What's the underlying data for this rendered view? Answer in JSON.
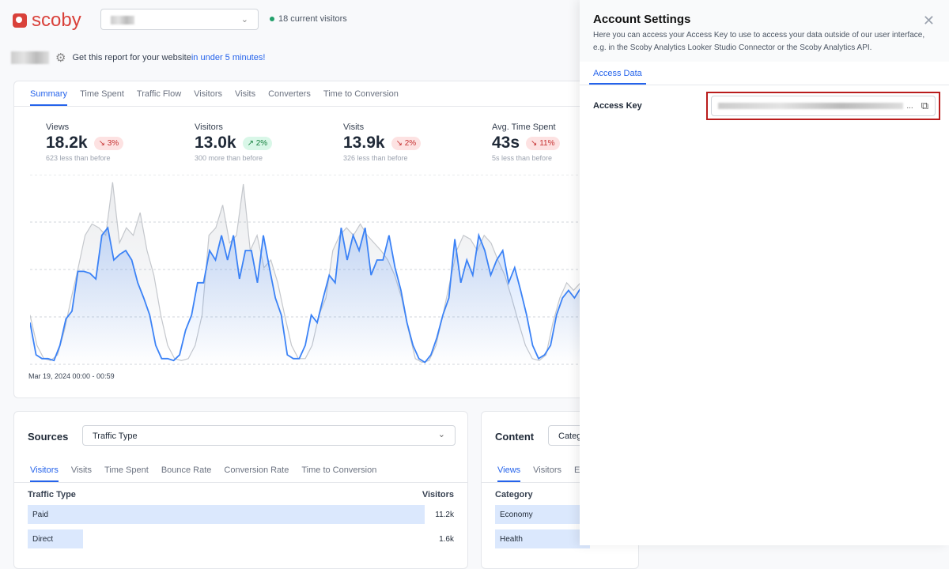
{
  "header": {
    "logo": "scoby",
    "site_select_icon": "chevron-down-icon",
    "current_visitors": "18 current visitors",
    "status_color": "#22a06b"
  },
  "promo": {
    "text": "Get this report for your website ",
    "link": "in under 5 minutes!"
  },
  "summary": {
    "tabs": [
      "Summary",
      "Time Spent",
      "Traffic Flow",
      "Visitors",
      "Visits",
      "Converters",
      "Time to Conversion"
    ],
    "kpis": [
      {
        "label": "Views",
        "value": "18.2k",
        "change": "3%",
        "direction": "down",
        "sub": "623 less than before"
      },
      {
        "label": "Visitors",
        "value": "13.0k",
        "change": "2%",
        "direction": "up",
        "sub": "300 more than before"
      },
      {
        "label": "Visits",
        "value": "13.9k",
        "change": "2%",
        "direction": "down",
        "sub": "326 less than before"
      },
      {
        "label": "Avg. Time Spent",
        "value": "43s",
        "change": "11%",
        "direction": "down",
        "sub": "5s less than before"
      }
    ],
    "date_label": "Mar 19, 2024 00:00 - 00:59"
  },
  "chart_data": {
    "type": "area",
    "grid": true,
    "series": [
      {
        "color": "#3b82f6",
        "values": [
          22,
          5,
          3,
          3,
          2,
          10,
          24,
          28,
          49,
          49,
          48,
          45,
          68,
          72,
          55,
          58,
          60,
          55,
          43,
          35,
          26,
          10,
          3,
          3,
          2,
          5,
          18,
          26,
          43,
          43,
          60,
          55,
          68,
          55,
          68,
          45,
          60,
          60,
          43,
          68,
          51,
          35,
          26,
          5,
          3,
          3,
          10,
          26,
          22,
          35,
          47,
          43,
          72,
          55,
          68,
          60,
          72,
          47,
          55,
          55,
          68,
          51,
          39,
          22,
          10,
          3,
          1,
          5,
          14,
          26,
          35,
          66,
          43,
          55,
          47,
          68,
          60,
          47,
          55,
          60,
          43,
          51,
          39,
          26,
          10,
          3,
          5,
          10,
          26,
          35,
          39,
          35,
          40
        ]
      },
      {
        "color": "#c4c7cc",
        "values": [
          26,
          10,
          3,
          2,
          5,
          18,
          35,
          51,
          68,
          74,
          72,
          68,
          96,
          64,
          72,
          68,
          80,
          60,
          47,
          26,
          10,
          3,
          2,
          3,
          10,
          26,
          68,
          72,
          84,
          64,
          68,
          95,
          60,
          68,
          51,
          55,
          43,
          26,
          10,
          3,
          3,
          10,
          26,
          35,
          60,
          68,
          72,
          68,
          74,
          68,
          64,
          60,
          55,
          47,
          35,
          18,
          3,
          1,
          2,
          10,
          26,
          43,
          60,
          68,
          66,
          60,
          68,
          64,
          55,
          47,
          35,
          22,
          10,
          3,
          2,
          5,
          22,
          35,
          43,
          39,
          43
        ]
      }
    ]
  },
  "sources": {
    "title": "Sources",
    "select": "Traffic Type",
    "tabs": [
      "Visitors",
      "Visits",
      "Time Spent",
      "Bounce Rate",
      "Conversion Rate",
      "Time to Conversion"
    ],
    "col1": "Traffic Type",
    "col2": "Visitors",
    "rows": [
      {
        "label": "Paid",
        "value": "11.2k",
        "share": 1
      },
      {
        "label": "Direct",
        "value": "1.6k",
        "share": 0.14
      }
    ]
  },
  "content": {
    "title": "Content",
    "select": "Categ",
    "tabs": [
      "Views",
      "Visitors",
      "En"
    ],
    "col1": "Category",
    "rows": [
      {
        "label": "Economy"
      },
      {
        "label": "Health"
      }
    ]
  },
  "panel": {
    "title": "Account Settings",
    "description": "Here you can access your Access Key to use to access your data outside of our user interface, e.g. in the Scoby Analytics Looker Studio Connector or the Scoby Analytics API.",
    "tab": "Access Data",
    "key_label": "Access Key",
    "ellipsis": "...",
    "highlight_color": "#b91c1c"
  }
}
